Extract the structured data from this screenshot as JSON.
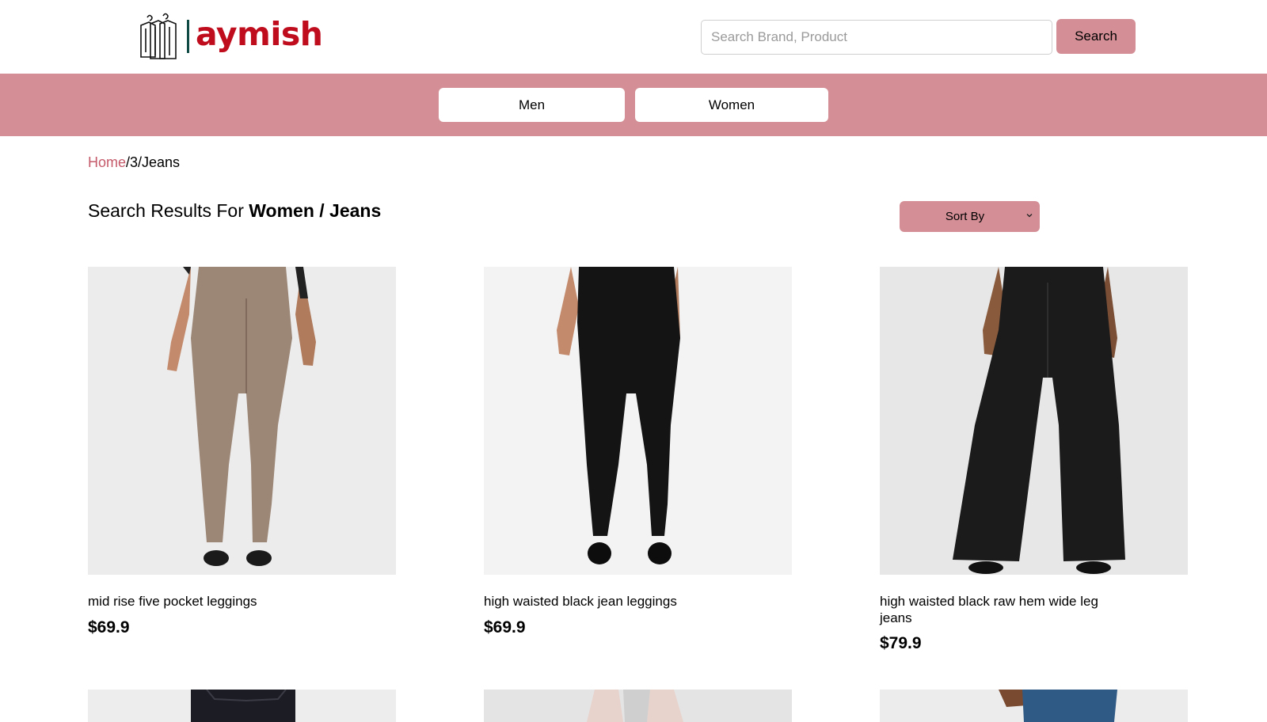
{
  "brand": {
    "name": "aymish",
    "color": "#c00d1e",
    "accent": "#d48f96"
  },
  "search": {
    "placeholder": "Search Brand, Product",
    "value": "",
    "button_label": "Search"
  },
  "categories": [
    {
      "label": "Men"
    },
    {
      "label": "Women"
    }
  ],
  "breadcrumb": {
    "home": "Home",
    "rest": "/3/Jeans"
  },
  "results": {
    "prefix": "Search Results For ",
    "query": "Women / Jeans"
  },
  "sort": {
    "label": "Sort By"
  },
  "products": [
    {
      "name": "mid rise five pocket leggings",
      "price": "$69.9",
      "image": "taupe-skinny-leggings"
    },
    {
      "name": "high waisted black jean leggings",
      "price": "$69.9",
      "image": "black-jean-leggings"
    },
    {
      "name": "high waisted black raw hem wide leg jeans",
      "price": "$79.9",
      "image": "black-wide-leg-jeans"
    },
    {
      "name": "",
      "price": "",
      "image": "dark-denim-jeans"
    },
    {
      "name": "",
      "price": "",
      "image": "light-pink-jacket"
    },
    {
      "name": "",
      "price": "",
      "image": "blue-denim-jeans"
    }
  ]
}
